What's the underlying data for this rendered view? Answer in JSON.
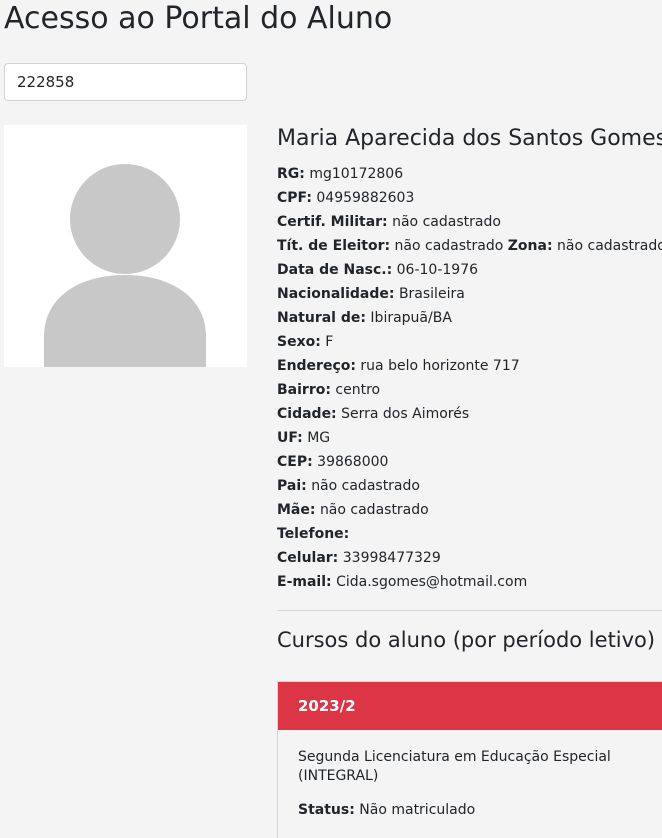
{
  "page": {
    "title": "Acesso ao Portal do Aluno"
  },
  "search": {
    "value": "222858"
  },
  "student": {
    "name": "Maria Aparecida dos Santos Gomes",
    "rg_label": "RG:",
    "rg": "mg10172806",
    "cpf_label": "CPF:",
    "cpf": "04959882603",
    "military_label": "Certif. Militar:",
    "military": "não cadastrado",
    "voter_label": "Tít. de Eleitor:",
    "voter": "não cadastrado",
    "zone_label": "Zona:",
    "zone": "não cadastrado",
    "birth_label": "Data de Nasc.:",
    "birth": "06-10-1976",
    "nationality_label": "Nacionalidade:",
    "nationality": "Brasileira",
    "birthplace_label": "Natural de:",
    "birthplace": "Ibirapuã/BA",
    "sex_label": "Sexo:",
    "sex": "F",
    "address_label": "Endereço:",
    "address": "rua belo horizonte 717",
    "district_label": "Bairro:",
    "district": "centro",
    "city_label": "Cidade:",
    "city": "Serra dos Aimorés",
    "state_label": "UF:",
    "state": "MG",
    "zip_label": "CEP:",
    "zip": "39868000",
    "father_label": "Pai:",
    "father": "não cadastrado",
    "mother_label": "Mãe:",
    "mother": "não cadastrado",
    "phone_label": "Telefone:",
    "phone": "",
    "mobile_label": "Celular:",
    "mobile": "33998477329",
    "email_label": "E-mail:",
    "email": "Cida.sgomes@hotmail.com"
  },
  "courses": {
    "title": "Cursos do aluno (por período letivo)",
    "items": [
      {
        "period": "2023/2",
        "name": "Segunda Licenciatura em Educação Especial (INTEGRAL)",
        "status_label": "Status:",
        "status": "Não matriculado"
      }
    ]
  },
  "colors": {
    "background": "#f4f4f4",
    "accent": "#dc3545",
    "avatar_placeholder": "#c8c8c8"
  },
  "icons": {
    "avatar": "user-silhouette-icon"
  }
}
